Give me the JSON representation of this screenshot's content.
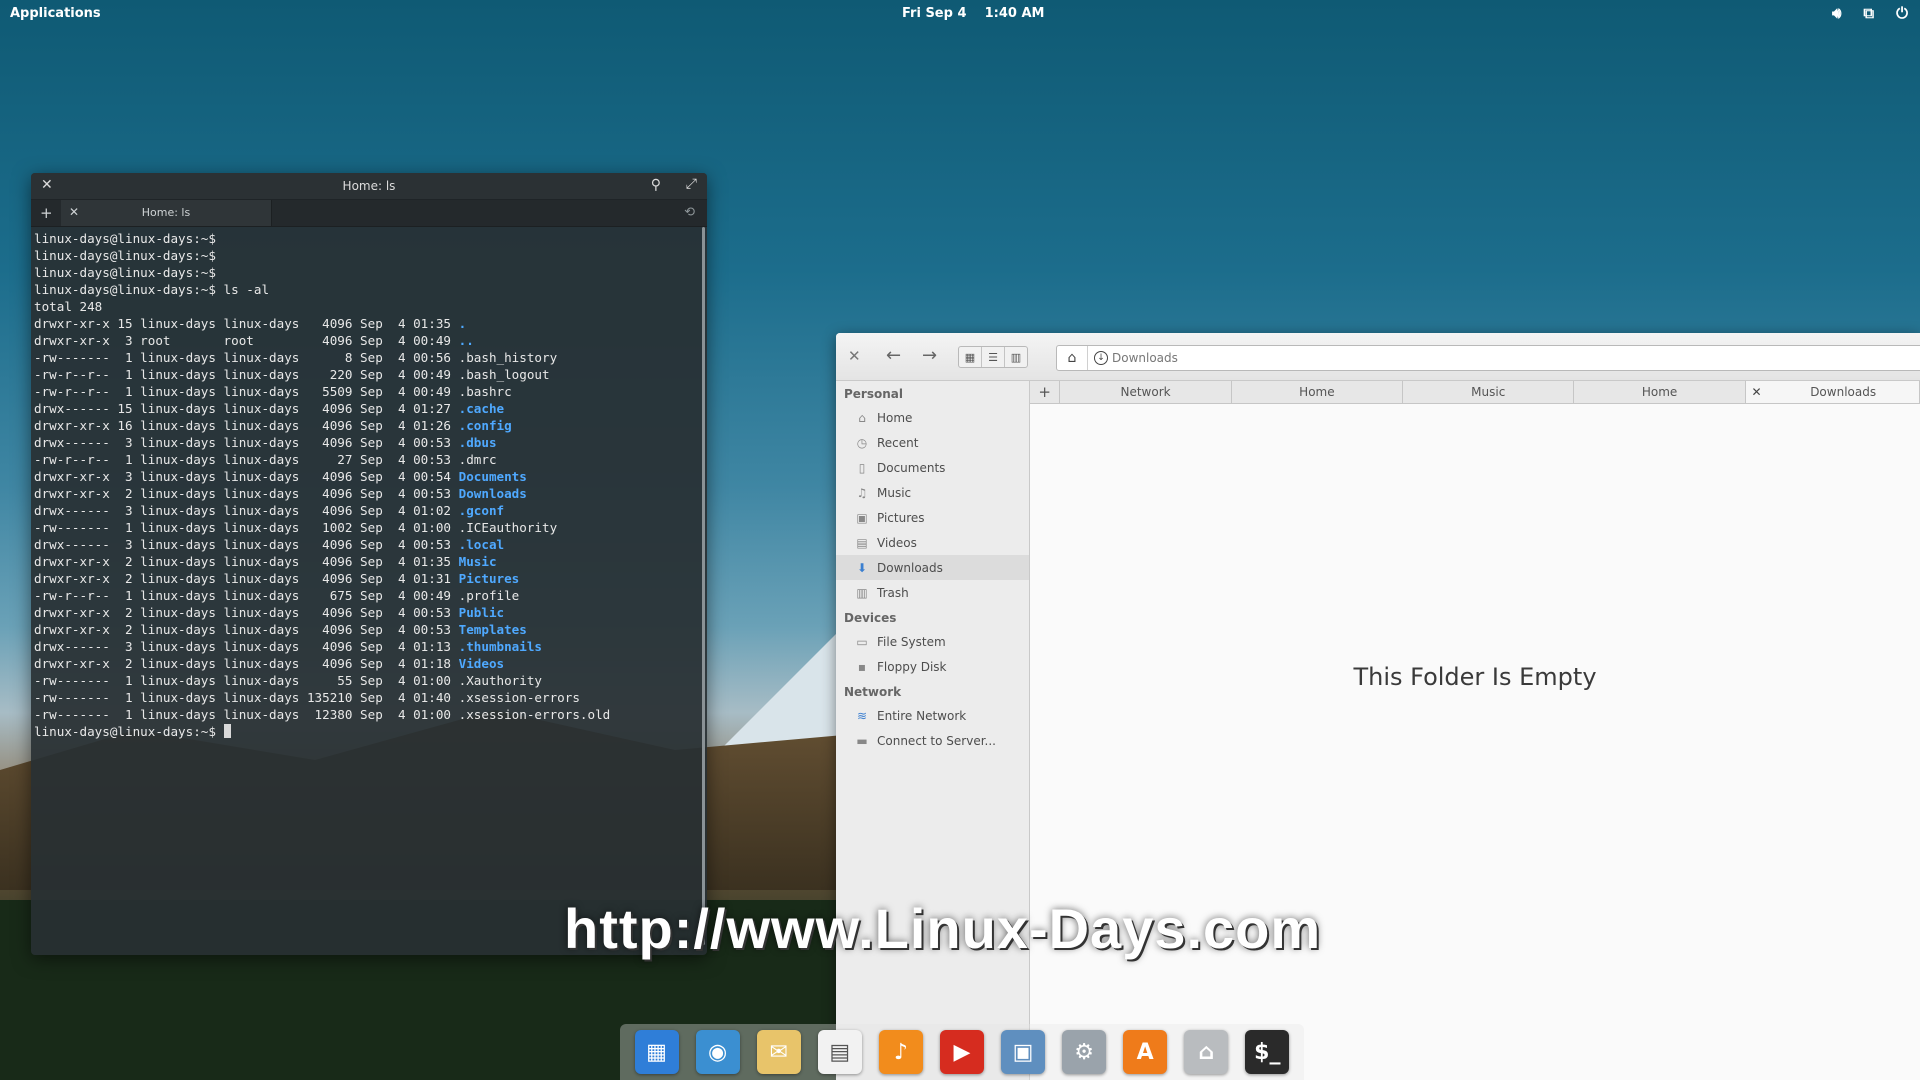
{
  "panel": {
    "applications": "Applications",
    "date": "Fri Sep  4",
    "time": "1:40 AM",
    "indicators": [
      "volume-icon",
      "network-icon",
      "power-icon"
    ]
  },
  "terminal": {
    "title": "Home: ls",
    "tab_label": "Home: ls",
    "lines": [
      {
        "text": "linux-days@linux-days:~$ ",
        "entry": ""
      },
      {
        "text": "linux-days@linux-days:~$ ",
        "entry": ""
      },
      {
        "text": "linux-days@linux-days:~$ ",
        "entry": ""
      },
      {
        "text": "linux-days@linux-days:~$ ls -al",
        "entry": ""
      },
      {
        "text": "total 248",
        "entry": ""
      },
      {
        "text": "drwxr-xr-x 15 linux-days linux-days   4096 Sep  4 01:35 ",
        "entry": ".",
        "dir": true
      },
      {
        "text": "drwxr-xr-x  3 root       root         4096 Sep  4 00:49 ",
        "entry": "..",
        "dir": true
      },
      {
        "text": "-rw-------  1 linux-days linux-days      8 Sep  4 00:56 ",
        "entry": ".bash_history"
      },
      {
        "text": "-rw-r--r--  1 linux-days linux-days    220 Sep  4 00:49 ",
        "entry": ".bash_logout"
      },
      {
        "text": "-rw-r--r--  1 linux-days linux-days   5509 Sep  4 00:49 ",
        "entry": ".bashrc"
      },
      {
        "text": "drwx------ 15 linux-days linux-days   4096 Sep  4 01:27 ",
        "entry": ".cache",
        "dir": true
      },
      {
        "text": "drwxr-xr-x 16 linux-days linux-days   4096 Sep  4 01:26 ",
        "entry": ".config",
        "dir": true
      },
      {
        "text": "drwx------  3 linux-days linux-days   4096 Sep  4 00:53 ",
        "entry": ".dbus",
        "dir": true
      },
      {
        "text": "-rw-r--r--  1 linux-days linux-days     27 Sep  4 00:53 ",
        "entry": ".dmrc"
      },
      {
        "text": "drwxr-xr-x  3 linux-days linux-days   4096 Sep  4 00:54 ",
        "entry": "Documents",
        "dir": true
      },
      {
        "text": "drwxr-xr-x  2 linux-days linux-days   4096 Sep  4 00:53 ",
        "entry": "Downloads",
        "dir": true
      },
      {
        "text": "drwx------  3 linux-days linux-days   4096 Sep  4 01:02 ",
        "entry": ".gconf",
        "dir": true
      },
      {
        "text": "-rw-------  1 linux-days linux-days   1002 Sep  4 01:00 ",
        "entry": ".ICEauthority"
      },
      {
        "text": "drwx------  3 linux-days linux-days   4096 Sep  4 00:53 ",
        "entry": ".local",
        "dir": true
      },
      {
        "text": "drwxr-xr-x  2 linux-days linux-days   4096 Sep  4 01:35 ",
        "entry": "Music",
        "dir": true
      },
      {
        "text": "drwxr-xr-x  2 linux-days linux-days   4096 Sep  4 01:31 ",
        "entry": "Pictures",
        "dir": true
      },
      {
        "text": "-rw-r--r--  1 linux-days linux-days    675 Sep  4 00:49 ",
        "entry": ".profile"
      },
      {
        "text": "drwxr-xr-x  2 linux-days linux-days   4096 Sep  4 00:53 ",
        "entry": "Public",
        "dir": true
      },
      {
        "text": "drwxr-xr-x  2 linux-days linux-days   4096 Sep  4 00:53 ",
        "entry": "Templates",
        "dir": true
      },
      {
        "text": "drwx------  3 linux-days linux-days   4096 Sep  4 01:13 ",
        "entry": ".thumbnails",
        "dir": true
      },
      {
        "text": "drwxr-xr-x  2 linux-days linux-days   4096 Sep  4 01:18 ",
        "entry": "Videos",
        "dir": true
      },
      {
        "text": "-rw-------  1 linux-days linux-days     55 Sep  4 01:00 ",
        "entry": ".Xauthority"
      },
      {
        "text": "-rw-------  1 linux-days linux-days 135210 Sep  4 01:40 ",
        "entry": ".xsession-errors"
      },
      {
        "text": "-rw-------  1 linux-days linux-days  12380 Sep  4 01:00 ",
        "entry": ".xsession-errors.old"
      }
    ],
    "prompt": "linux-days@linux-days:~$ "
  },
  "filemanager": {
    "path_current": "Downloads",
    "sidebar": {
      "personal_label": "Personal",
      "personal": [
        {
          "label": "Home",
          "icon": "home-icon"
        },
        {
          "label": "Recent",
          "icon": "clock-icon"
        },
        {
          "label": "Documents",
          "icon": "document-icon"
        },
        {
          "label": "Music",
          "icon": "music-icon"
        },
        {
          "label": "Pictures",
          "icon": "picture-icon"
        },
        {
          "label": "Videos",
          "icon": "video-icon"
        },
        {
          "label": "Downloads",
          "icon": "download-icon"
        },
        {
          "label": "Trash",
          "icon": "trash-icon"
        }
      ],
      "devices_label": "Devices",
      "devices": [
        {
          "label": "File System",
          "icon": "drive-icon"
        },
        {
          "label": "Floppy Disk",
          "icon": "floppy-icon"
        }
      ],
      "network_label": "Network",
      "network": [
        {
          "label": "Entire Network",
          "icon": "wifi-icon"
        },
        {
          "label": "Connect to Server...",
          "icon": "server-icon"
        }
      ]
    },
    "tabs": [
      "Network",
      "Home",
      "Music",
      "Home",
      "Downloads"
    ],
    "empty_message": "This Folder Is Empty"
  },
  "watermark": "http://www.Linux-Days.com",
  "dock": [
    {
      "name": "multitasking-view-icon",
      "color": "#2f7ed8"
    },
    {
      "name": "web-browser-icon",
      "color": "#3b8fd1"
    },
    {
      "name": "mail-icon",
      "color": "#e8c46a"
    },
    {
      "name": "calendar-icon",
      "color": "#f2f2f2"
    },
    {
      "name": "music-player-icon",
      "color": "#f28c1c"
    },
    {
      "name": "video-player-icon",
      "color": "#d62c1f"
    },
    {
      "name": "photos-icon",
      "color": "#5f8fbf"
    },
    {
      "name": "settings-icon",
      "color": "#9aa3ab"
    },
    {
      "name": "app-center-icon",
      "color": "#ef7b1a"
    },
    {
      "name": "files-icon",
      "color": "#b9bcbf"
    },
    {
      "name": "terminal-icon",
      "color": "#2a2a2a"
    }
  ]
}
